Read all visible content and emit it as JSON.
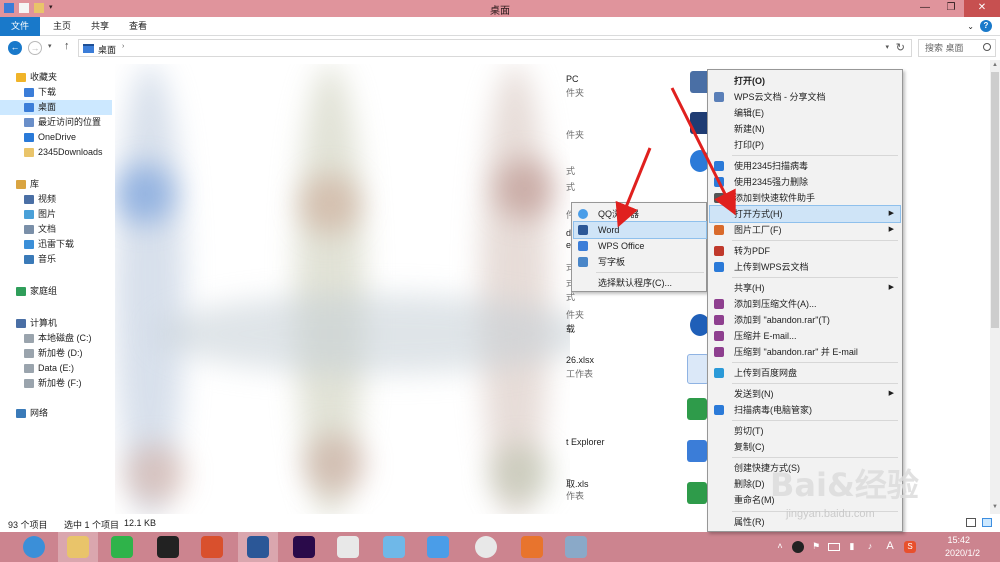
{
  "window": {
    "title": "桌面"
  },
  "ribbon": {
    "tabs": [
      "文件",
      "主页",
      "共享",
      "查看"
    ]
  },
  "address": {
    "crumb": "桌面",
    "search_placeholder": "搜索 桌面"
  },
  "sidebar": {
    "items": [
      {
        "label": "收藏夹",
        "icon": "star-icon",
        "color": "#f0b429"
      },
      {
        "label": "下载",
        "icon": "download-folder-icon",
        "color": "#3b7dd8"
      },
      {
        "label": "桌面",
        "icon": "desktop-folder-icon",
        "color": "#3b7dd8"
      },
      {
        "label": "最近访问的位置",
        "icon": "recent-places-icon",
        "color": "#6a8fc9"
      },
      {
        "label": "OneDrive",
        "icon": "cloud-icon",
        "color": "#2a7ad8"
      },
      {
        "label": "2345Downloads",
        "icon": "folder-icon",
        "color": "#e9c46a"
      },
      {
        "label": "库",
        "icon": "library-icon",
        "color": "#d9a441"
      },
      {
        "label": "视频",
        "icon": "videos-icon",
        "color": "#4a6fa5"
      },
      {
        "label": "图片",
        "icon": "pictures-icon",
        "color": "#4aa0d8"
      },
      {
        "label": "文档",
        "icon": "documents-icon",
        "color": "#7a8fa8"
      },
      {
        "label": "迅雷下载",
        "icon": "thunder-folder-icon",
        "color": "#3b8fd8"
      },
      {
        "label": "音乐",
        "icon": "music-icon",
        "color": "#3a7ab8"
      },
      {
        "label": "家庭组",
        "icon": "homegroup-icon",
        "color": "#2f9e5a"
      },
      {
        "label": "计算机",
        "icon": "computer-icon",
        "color": "#4a6fa5"
      },
      {
        "label": "本地磁盘 (C:)",
        "icon": "drive-c-icon",
        "color": "#9aa4ad"
      },
      {
        "label": "新加卷 (D:)",
        "icon": "drive-icon",
        "color": "#9aa4ad"
      },
      {
        "label": "Data (E:)",
        "icon": "drive-icon",
        "color": "#9aa4ad"
      },
      {
        "label": "新加卷 (F:)",
        "icon": "drive-icon",
        "color": "#9aa4ad"
      },
      {
        "label": "网络",
        "icon": "network-icon",
        "color": "#3a7ab8"
      }
    ]
  },
  "files": {
    "texts": [
      "PC",
      "件夹",
      "件夹",
      "式",
      "式",
      "件夹",
      "d",
      "e",
      "式",
      "式",
      "式",
      "件夹",
      "载",
      "26.xlsx",
      "工作表",
      "t Explorer",
      "取.xls",
      "作表"
    ]
  },
  "status": {
    "count": "93 个项目",
    "selected": "选中 1 个项目",
    "size": "12.1 KB"
  },
  "context_menu": {
    "items": [
      {
        "label": "打开(O)",
        "bold": true,
        "icon": "",
        "arrow": false
      },
      {
        "label": "WPS云文档 - 分享文档",
        "icon": "share-icon",
        "arrow": false
      },
      {
        "label": "编辑(E)",
        "icon": "",
        "arrow": false
      },
      {
        "label": "新建(N)",
        "icon": "",
        "arrow": false
      },
      {
        "label": "打印(P)",
        "icon": "",
        "arrow": false
      },
      {
        "label": "使用2345扫描病毒",
        "icon": "shield-icon",
        "arrow": false
      },
      {
        "label": "使用2345强力删除",
        "icon": "delete-icon",
        "arrow": false
      },
      {
        "label": "添加到快速软件助手",
        "icon": "assistant-icon",
        "arrow": false
      },
      {
        "label": "打开方式(H)",
        "icon": "",
        "arrow": true,
        "highlight": true
      },
      {
        "label": "图片工厂(F)",
        "icon": "picture-factory-icon",
        "arrow": true
      },
      {
        "label": "转为PDF",
        "icon": "pdf-icon",
        "arrow": false
      },
      {
        "label": "上传到WPS云文档",
        "icon": "wps-cloud-icon",
        "arrow": false
      },
      {
        "label": "共享(H)",
        "icon": "",
        "arrow": true
      },
      {
        "label": "添加到压缩文件(A)...",
        "icon": "winrar-icon",
        "arrow": false
      },
      {
        "label": "添加到 \"abandon.rar\"(T)",
        "icon": "winrar-icon",
        "arrow": false
      },
      {
        "label": "压缩并 E-mail...",
        "icon": "winrar-icon",
        "arrow": false
      },
      {
        "label": "压缩到 \"abandon.rar\" 并 E-mail",
        "icon": "winrar-icon",
        "arrow": false
      },
      {
        "label": "上传到百度网盘",
        "icon": "baidu-netdisk-icon",
        "arrow": false
      },
      {
        "label": "发送到(N)",
        "icon": "",
        "arrow": true
      },
      {
        "label": "扫描病毒(电脑管家)",
        "icon": "pc-manager-icon",
        "arrow": false
      },
      {
        "label": "剪切(T)",
        "icon": "",
        "arrow": false
      },
      {
        "label": "复制(C)",
        "icon": "",
        "arrow": false
      },
      {
        "label": "创建快捷方式(S)",
        "icon": "",
        "arrow": false
      },
      {
        "label": "删除(D)",
        "icon": "",
        "arrow": false
      },
      {
        "label": "重命名(M)",
        "icon": "",
        "arrow": false
      },
      {
        "label": "属性(R)",
        "icon": "",
        "arrow": false
      }
    ]
  },
  "submenu": {
    "items": [
      {
        "label": "QQ浏览器",
        "icon": "qq-browser-icon",
        "color": "#4a9de8"
      },
      {
        "label": "Word",
        "icon": "word-icon",
        "color": "#2b5797",
        "highlight": true
      },
      {
        "label": "WPS Office",
        "icon": "wps-office-icon",
        "color": "#3b7dd8"
      },
      {
        "label": "写字板",
        "icon": "wordpad-icon",
        "color": "#4a86c8"
      },
      {
        "label": "选择默认程序(C)...",
        "icon": "",
        "color": ""
      }
    ]
  },
  "taskbar": {
    "apps": [
      "2345-browser-icon",
      "file-explorer-icon",
      "wechat-icon",
      "qq-icon",
      "wps-presentation-icon",
      "word-icon",
      "premiere-icon",
      "xmind-icon",
      "cloud-bird-icon",
      "feishu-icon",
      "chrome-icon",
      "firefox-icon",
      "book-icon"
    ],
    "tray": [
      "chevron-up-icon",
      "qq-tray-icon",
      "flag-icon",
      "battery-icon",
      "network-tray-icon",
      "volume-icon",
      "ime-icon",
      "sogou-icon"
    ],
    "ime_label": "A",
    "sogou_label": "S",
    "time": "15:42",
    "date": "2020/1/2"
  },
  "watermark": {
    "text": "Bai&经验",
    "url": "jingyan.baidu.com"
  },
  "colors": {
    "titlebar": "#e0949c",
    "taskbar": "#cc848f",
    "accent": "#1979ca",
    "arrow": "#e0201e"
  }
}
